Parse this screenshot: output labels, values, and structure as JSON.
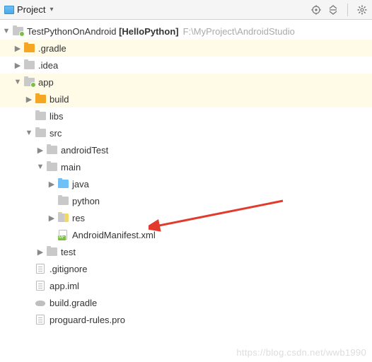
{
  "toolbar": {
    "project_label": "Project"
  },
  "tree": {
    "root": {
      "name": "TestPythonOnAndroid",
      "badge": "[HelloPython]",
      "path": "F:\\MyProject\\AndroidStudio"
    },
    "gradle_dir": ".gradle",
    "idea_dir": ".idea",
    "app_dir": "app",
    "build_dir": "build",
    "libs_dir": "libs",
    "src_dir": "src",
    "androidTest_dir": "androidTest",
    "main_dir": "main",
    "java_dir": "java",
    "python_dir": "python",
    "res_dir": "res",
    "manifest_file": "AndroidManifest.xml",
    "test_dir": "test",
    "gitignore_file": ".gitignore",
    "app_iml_file": "app.iml",
    "build_gradle_file": "build.gradle",
    "proguard_file": "proguard-rules.pro"
  },
  "watermark": "https://blog.csdn.net/wwb1990"
}
